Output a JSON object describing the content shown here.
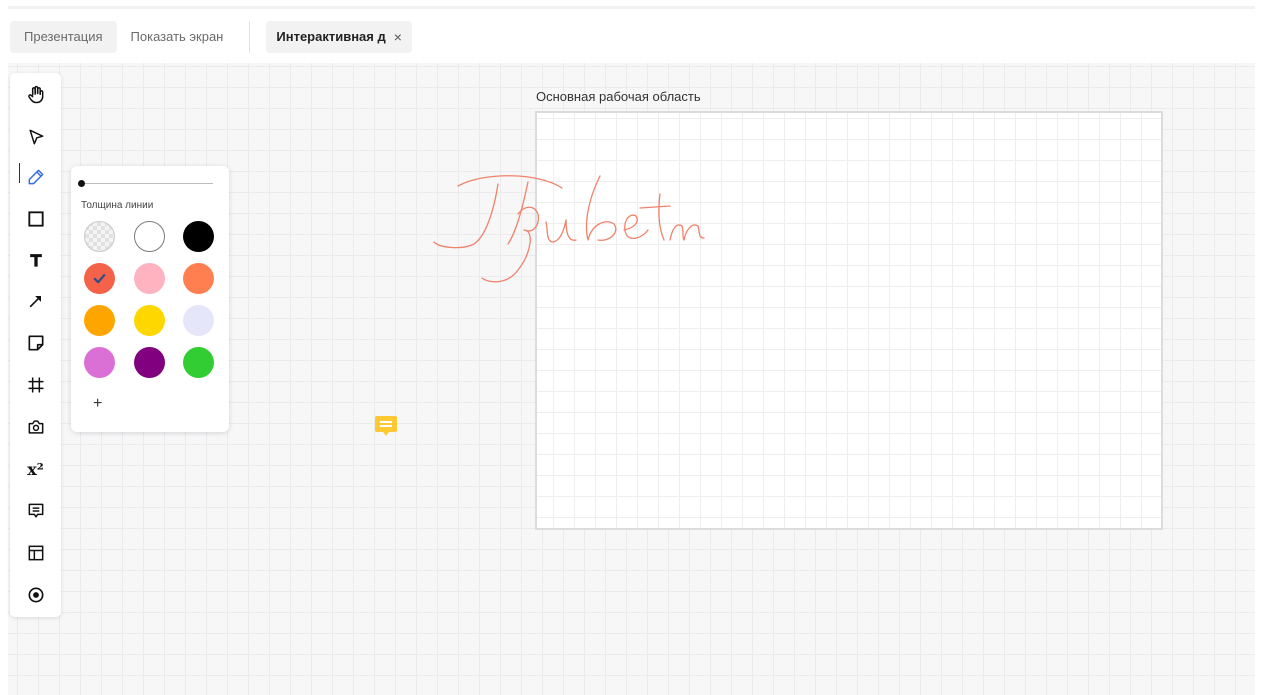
{
  "tabs": [
    {
      "label": "Презентация"
    },
    {
      "label": "Показать экран"
    },
    {
      "label": "Интерактивная д",
      "close": "×"
    }
  ],
  "toolbar": {
    "tools": [
      {
        "name": "hand-icon",
        "active": false
      },
      {
        "name": "cursor-icon",
        "active": false
      },
      {
        "name": "pencil-icon",
        "active": true
      },
      {
        "name": "rectangle-icon",
        "active": false
      },
      {
        "name": "text-icon",
        "active": false
      },
      {
        "name": "arrow-icon",
        "active": false
      },
      {
        "name": "sticky-note-icon",
        "active": false
      },
      {
        "name": "frame-hash-icon",
        "active": false
      },
      {
        "name": "camera-icon",
        "active": false
      },
      {
        "name": "formula-icon",
        "active": false,
        "glyph": "x²"
      },
      {
        "name": "comment-icon",
        "active": false
      },
      {
        "name": "template-icon",
        "active": false
      },
      {
        "name": "target-icon",
        "active": false
      }
    ]
  },
  "pen_panel": {
    "line_width_label": "Толщина линии",
    "line_width": 0,
    "add_label": "+",
    "colors": [
      {
        "hex": "transparent",
        "selected": false
      },
      {
        "hex": "#ffffff",
        "selected": false
      },
      {
        "hex": "#000000",
        "selected": false
      },
      {
        "hex": "#f4624a",
        "selected": true
      },
      {
        "hex": "#ffb3c1",
        "selected": false
      },
      {
        "hex": "#ff7f50",
        "selected": false
      },
      {
        "hex": "#ffa500",
        "selected": false
      },
      {
        "hex": "#ffd700",
        "selected": false
      },
      {
        "hex": "#e6e6fa",
        "selected": false
      },
      {
        "hex": "#da70d6",
        "selected": false
      },
      {
        "hex": "#800080",
        "selected": false
      },
      {
        "hex": "#32cd32",
        "selected": false
      }
    ]
  },
  "board": {
    "frame_title": "Основная рабочая область",
    "ink_color": "#f0826a",
    "comment_color": "#ffc933"
  }
}
